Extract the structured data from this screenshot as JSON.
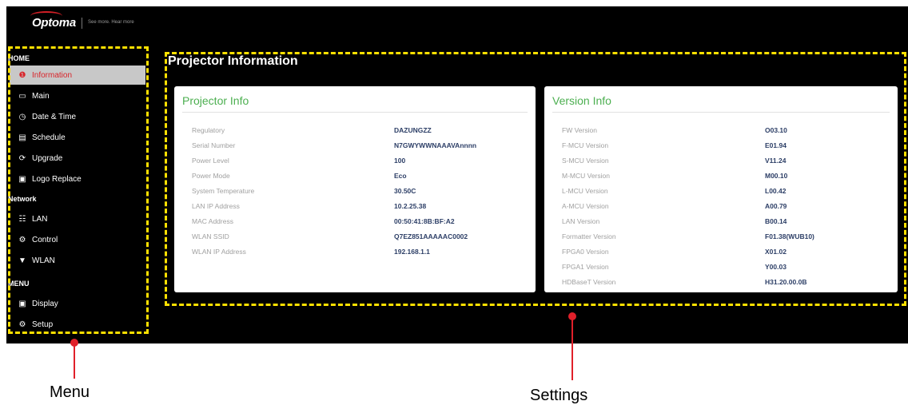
{
  "header": {
    "brand": "Optoma",
    "tagline": "See more. Hear more"
  },
  "sidebar": {
    "sections": [
      {
        "label": "HOME"
      },
      {
        "label": "Network"
      },
      {
        "label": "MENU"
      }
    ],
    "items": [
      {
        "label": "Information",
        "icon": "info-icon",
        "active": true
      },
      {
        "label": "Main",
        "icon": "monitor-icon"
      },
      {
        "label": "Date & Time",
        "icon": "clock-icon"
      },
      {
        "label": "Schedule",
        "icon": "calendar-icon"
      },
      {
        "label": "Upgrade",
        "icon": "refresh-icon"
      },
      {
        "label": "Logo Replace",
        "icon": "image-icon"
      },
      {
        "label": "LAN",
        "icon": "network-icon"
      },
      {
        "label": "Control",
        "icon": "gears-icon"
      },
      {
        "label": "WLAN",
        "icon": "wifi-icon"
      },
      {
        "label": "Display",
        "icon": "image-icon"
      },
      {
        "label": "Setup",
        "icon": "gears-icon"
      }
    ]
  },
  "main": {
    "title": "Projector Information",
    "projector_info": {
      "title": "Projector Info",
      "rows": [
        {
          "label": "Regulatory",
          "value": "DAZUNGZZ"
        },
        {
          "label": "Serial Number",
          "value": "N7GWYWWNAAAVAnnnn"
        },
        {
          "label": "Power Level",
          "value": "100"
        },
        {
          "label": "Power Mode",
          "value": "Eco"
        },
        {
          "label": "System Temperature",
          "value": "30.50C"
        },
        {
          "label": "LAN IP Address",
          "value": "10.2.25.38"
        },
        {
          "label": "MAC Address",
          "value": "00:50:41:8B:BF:A2"
        },
        {
          "label": "WLAN SSID",
          "value": "Q7EZ851AAAAAC0002"
        },
        {
          "label": "WLAN IP Address",
          "value": "192.168.1.1"
        }
      ]
    },
    "version_info": {
      "title": "Version Info",
      "rows": [
        {
          "label": "FW Version",
          "value": "O03.10"
        },
        {
          "label": "F-MCU Version",
          "value": "E01.94"
        },
        {
          "label": "S-MCU Version",
          "value": "V11.24"
        },
        {
          "label": "M-MCU Version",
          "value": "M00.10"
        },
        {
          "label": "L-MCU Version",
          "value": "L00.42"
        },
        {
          "label": "A-MCU Version",
          "value": "A00.79"
        },
        {
          "label": "LAN Version",
          "value": "B00.14"
        },
        {
          "label": "Formatter Version",
          "value": "F01.38(WUB10)"
        },
        {
          "label": "FPGA0 Version",
          "value": "X01.02"
        },
        {
          "label": "FPGA1 Version",
          "value": "Y00.03"
        },
        {
          "label": "HDBaseT Version",
          "value": "H31.20.00.0B"
        }
      ]
    }
  },
  "annotations": {
    "menu_label": "Menu",
    "settings_label": "Settings",
    "highlight_color": "#ffe000",
    "callout_color": "#e0202a"
  }
}
